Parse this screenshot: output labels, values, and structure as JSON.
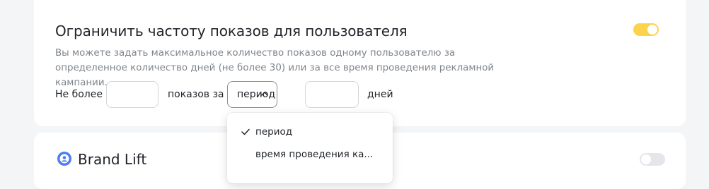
{
  "frequency": {
    "title": "Ограничить частоту показов для пользователя",
    "description": "Вы можете задать максимальное количество показов одному пользователю за определенное количество дней (не более 30) или за все время проведения рекламной кампании.",
    "enabled": true,
    "label_not_more": "Не более",
    "impressions_value": "",
    "label_impressions_for": "показов за",
    "period_select": {
      "selected": "период",
      "options": [
        "период",
        "время проведения ка..."
      ]
    },
    "days_value": "",
    "label_days": "дней"
  },
  "brand_lift": {
    "title": "Brand Lift",
    "enabled": false
  },
  "colors": {
    "toggle_on": "#fcd34d",
    "toggle_off": "#e5e6e9",
    "brand_icon": "#4d7cf5",
    "muted_text": "#7f858c"
  }
}
